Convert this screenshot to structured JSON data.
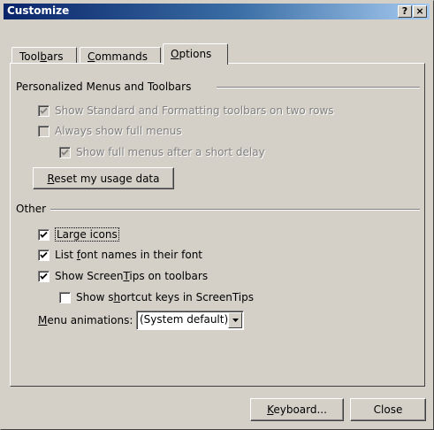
{
  "window": {
    "title": "Customize",
    "help_button": "?",
    "close_button": "×"
  },
  "tabs": [
    {
      "pre": "Tool",
      "key": "b",
      "post": "ars"
    },
    {
      "pre": "",
      "key": "C",
      "post": "ommands"
    },
    {
      "pre": "",
      "key": "O",
      "post": "ptions"
    }
  ],
  "active_tab": "Options",
  "personalized": {
    "heading": "Personalized Menus and Toolbars",
    "standard_formatting": {
      "label": "Show Standard and Formatting toolbars on two rows",
      "checked": true,
      "enabled": false
    },
    "always_full_menus": {
      "label": "Always show full menus",
      "checked": false,
      "enabled": false
    },
    "full_menus_delay": {
      "label": "Show full menus after a short delay",
      "checked": true,
      "enabled": false
    },
    "reset_button": {
      "key": "R",
      "rest": "eset my usage data"
    }
  },
  "other": {
    "heading": "Other",
    "large_icons": {
      "label": "Large icons",
      "checked": true
    },
    "font_names": {
      "pre": "List ",
      "key": "f",
      "post": "ont names in their font",
      "checked": true
    },
    "screentips": {
      "pre": "Show Screen",
      "key": "T",
      "post": "ips on toolbars",
      "checked": true
    },
    "shortcut_keys": {
      "pre": "Show s",
      "key": "h",
      "post": "ortcut keys in ScreenTips",
      "checked": false
    },
    "menu_animations": {
      "key": "M",
      "rest": "enu animations:",
      "value": "(System default)"
    }
  },
  "footer": {
    "keyboard_button": {
      "key": "K",
      "rest": "eyboard..."
    },
    "close_button": "Close"
  }
}
